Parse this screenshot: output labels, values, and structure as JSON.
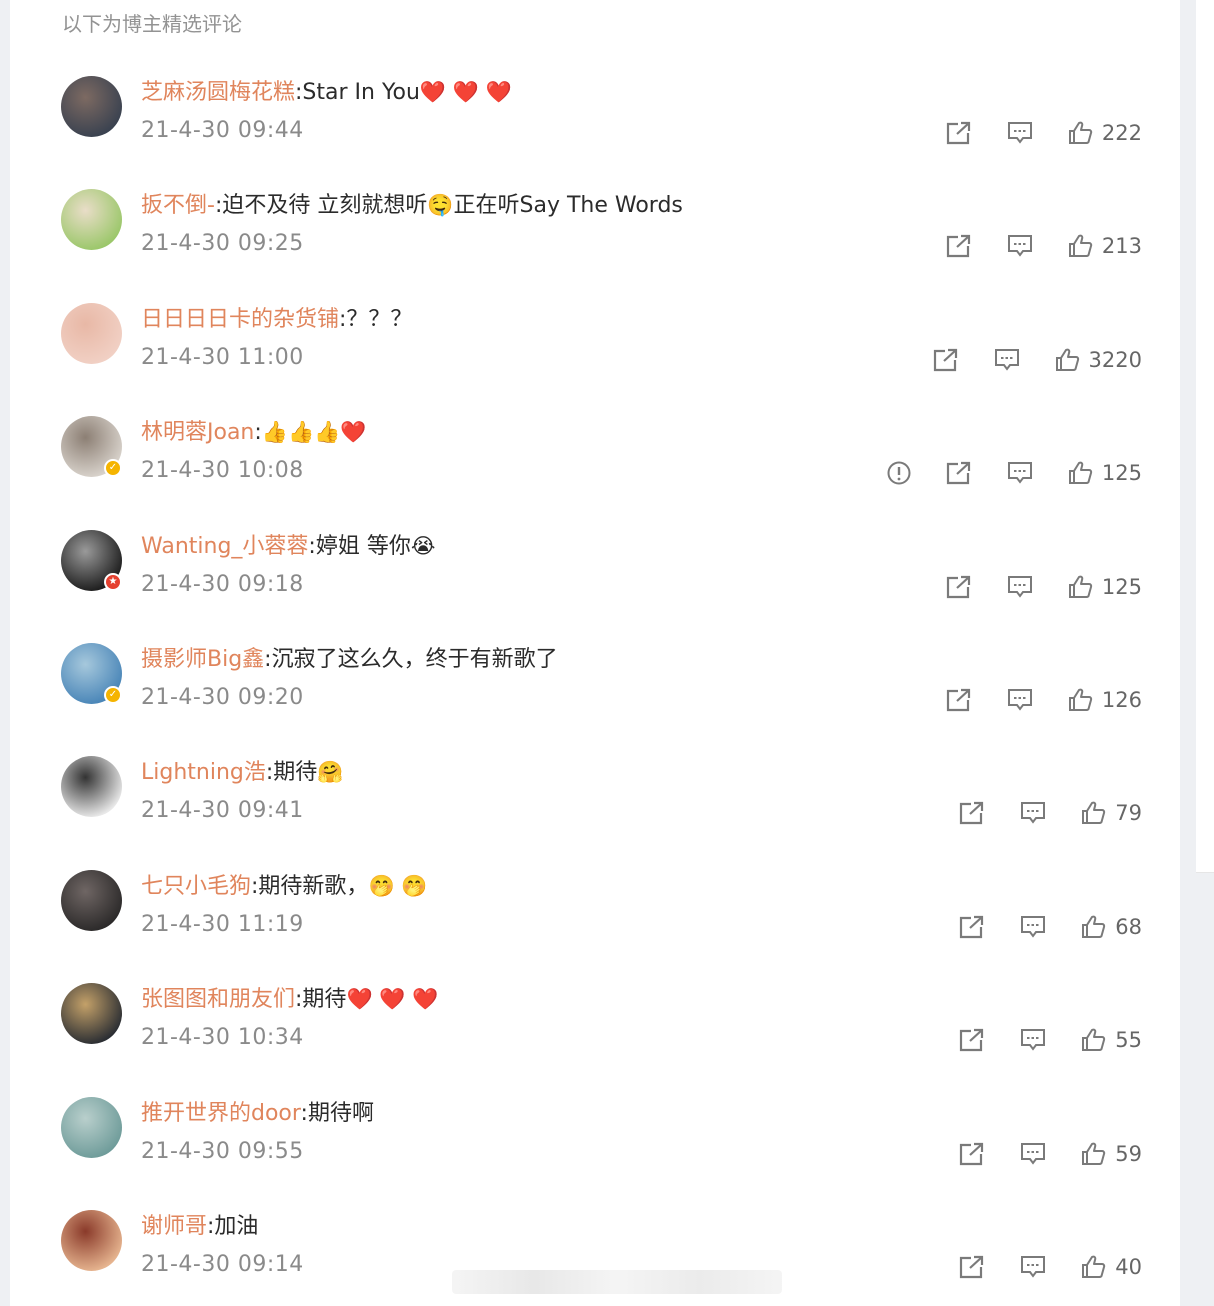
{
  "header": "以下为博主精选评论",
  "colors": {
    "username": "#e0855c",
    "text": "#2b2b2b",
    "meta": "#8a8a8a"
  },
  "comments": [
    {
      "user": "芝麻汤圆梅花糕",
      "text": ":Star In You",
      "emoji": [
        "heart-emoji",
        "heart-emoji",
        "heart-emoji"
      ],
      "emoji_chars": "❤️ ❤️ ❤️",
      "time": "21-4-30 09:44",
      "likes": "222",
      "badge": "",
      "report": false,
      "avatar_colors": [
        "#3a4250",
        "#7d6a62"
      ]
    },
    {
      "user": "扳不倒-",
      "text": ":迫不及待 立刻就想听",
      "emoji_chars": "🤤",
      "text2": "正在听Say The Words",
      "time": "21-4-30 09:25",
      "likes": "213",
      "badge": "",
      "report": false,
      "avatar_colors": [
        "#9bc76a",
        "#e9ddc8"
      ]
    },
    {
      "user": "日日日日卡的杂货铺",
      "text": ":？？？",
      "time": "21-4-30 11:00",
      "likes": "3220",
      "badge": "",
      "report": false,
      "avatar_colors": [
        "#f1d0c4",
        "#e8b8a6"
      ]
    },
    {
      "user": "林明蓉Joan",
      "text": ":",
      "emoji_chars": "👍👍👍❤️",
      "time": "21-4-30 10:08",
      "likes": "125",
      "badge": "gold",
      "report": true,
      "avatar_colors": [
        "#d8d2cb",
        "#8c7f74"
      ]
    },
    {
      "user": "Wanting_小蓉蓉",
      "text": ":婷姐 等你",
      "emoji_chars": "😭",
      "time": "21-4-30 09:18",
      "likes": "125",
      "badge": "red",
      "report": false,
      "avatar_colors": [
        "#1e1e1e",
        "#9a9a9a"
      ]
    },
    {
      "user": "摄影师Big鑫",
      "text": ":沉寂了这么久，终于有新歌了",
      "time": "21-4-30 09:20",
      "likes": "126",
      "badge": "gold",
      "report": false,
      "avatar_colors": [
        "#4a86b8",
        "#a6c8dc"
      ]
    },
    {
      "user": "Lightning浩",
      "text": ":期待",
      "emoji_chars": "🤗",
      "time": "21-4-30 09:41",
      "likes": "79",
      "badge": "",
      "report": false,
      "avatar_colors": [
        "#e8e8e8",
        "#333333"
      ]
    },
    {
      "user": "七只小毛狗",
      "text": ":期待新歌，",
      "emoji_chars": "🤭 🤭",
      "time": "21-4-30 11:19",
      "likes": "68",
      "badge": "",
      "report": false,
      "avatar_colors": [
        "#2c2a2a",
        "#6f6664"
      ]
    },
    {
      "user": "张图图和朋友们",
      "text": ":期待",
      "emoji_chars": "❤️ ❤️ ❤️",
      "time": "21-4-30 10:34",
      "likes": "55",
      "badge": "",
      "report": false,
      "avatar_colors": [
        "#2b2e33",
        "#c4a169"
      ]
    },
    {
      "user": "推开世界的door",
      "text": ":期待啊",
      "time": "21-4-30 09:55",
      "likes": "59",
      "badge": "",
      "report": false,
      "avatar_colors": [
        "#6f9c9a",
        "#b9cfcc"
      ]
    },
    {
      "user": "谢师哥",
      "text": ":加油",
      "time": "21-4-30 09:14",
      "likes": "40",
      "badge": "",
      "report": false,
      "avatar_colors": [
        "#e6b48f",
        "#8a3a2a"
      ]
    }
  ]
}
